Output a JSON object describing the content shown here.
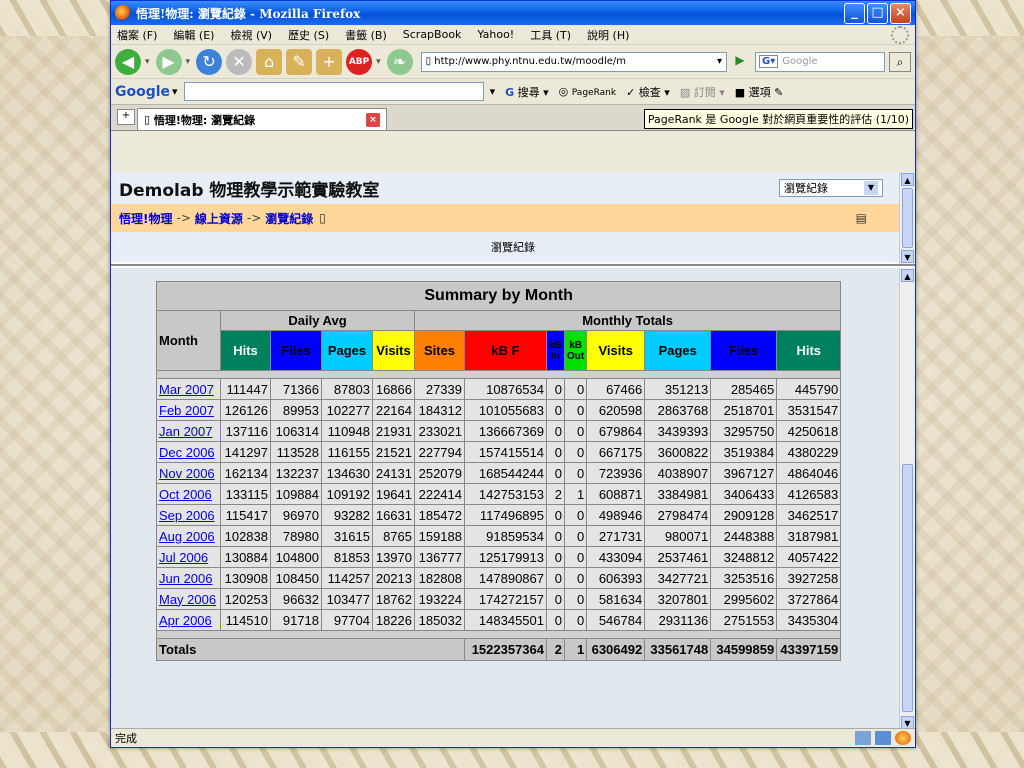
{
  "window": {
    "title": "悟理!物理: 瀏覽紀錄 - Mozilla Firefox",
    "minimize": "_",
    "maximize": "□",
    "close": "×"
  },
  "menu": [
    "檔案 (F)",
    "編輯 (E)",
    "檢視 (V)",
    "歷史 (S)",
    "書籤 (B)",
    "ScrapBook",
    "Yahoo!",
    "工具 (T)",
    "說明 (H)"
  ],
  "nav": {
    "url": "http://www.phy.ntnu.edu.tw/moodle/m",
    "search_placeholder": "Google"
  },
  "googlebar": {
    "logo": "Google",
    "search_label": "搜尋",
    "pagerank_label": "PageRank",
    "check_label": "檢查",
    "subscribe_label": "訂閱",
    "options_label": "選項"
  },
  "tab": {
    "label": "悟理!物理: 瀏覽紀錄",
    "tooltip": "PageRank 是 Google 對於網頁重要性的評估 (1/10)"
  },
  "page": {
    "site_title": "Demolab 物理教學示範實驗教室",
    "jump_select": "瀏覽紀錄",
    "breadcrumb": [
      "悟理!物理",
      "線上資源",
      "瀏覽紀錄"
    ],
    "breadcrumb_sep": "->",
    "subhead": "瀏覽紀錄"
  },
  "table": {
    "title": "Summary by Month",
    "month_label": "Month",
    "daily_avg_label": "Daily Avg",
    "monthly_totals_label": "Monthly Totals",
    "daily_cols": [
      "Hits",
      "Files",
      "Pages",
      "Visits"
    ],
    "monthly_cols": [
      "Sites",
      "kB F",
      "kB In",
      "kB Out",
      "Visits",
      "Pages",
      "Files",
      "Hits"
    ],
    "rows": [
      [
        "Mar 2007",
        "111447",
        "71366",
        "87803",
        "16866",
        "27339",
        "10876534",
        "0",
        "0",
        "67466",
        "351213",
        "285465",
        "445790"
      ],
      [
        "Feb 2007",
        "126126",
        "89953",
        "102277",
        "22164",
        "184312",
        "101055683",
        "0",
        "0",
        "620598",
        "2863768",
        "2518701",
        "3531547"
      ],
      [
        "Jan 2007",
        "137116",
        "106314",
        "110948",
        "21931",
        "233021",
        "136667369",
        "0",
        "0",
        "679864",
        "3439393",
        "3295750",
        "4250618"
      ],
      [
        "Dec 2006",
        "141297",
        "113528",
        "116155",
        "21521",
        "227794",
        "157415514",
        "0",
        "0",
        "667175",
        "3600822",
        "3519384",
        "4380229"
      ],
      [
        "Nov 2006",
        "162134",
        "132237",
        "134630",
        "24131",
        "252079",
        "168544244",
        "0",
        "0",
        "723936",
        "4038907",
        "3967127",
        "4864046"
      ],
      [
        "Oct 2006",
        "133115",
        "109884",
        "109192",
        "19641",
        "222414",
        "142753153",
        "2",
        "1",
        "608871",
        "3384981",
        "3406433",
        "4126583"
      ],
      [
        "Sep 2006",
        "115417",
        "96970",
        "93282",
        "16631",
        "185472",
        "117496895",
        "0",
        "0",
        "498946",
        "2798474",
        "2909128",
        "3462517"
      ],
      [
        "Aug 2006",
        "102838",
        "78980",
        "31615",
        "8765",
        "159188",
        "91859534",
        "0",
        "0",
        "271731",
        "980071",
        "2448388",
        "3187981"
      ],
      [
        "Jul 2006",
        "130884",
        "104800",
        "81853",
        "13970",
        "136777",
        "125179913",
        "0",
        "0",
        "433094",
        "2537461",
        "3248812",
        "4057422"
      ],
      [
        "Jun 2006",
        "130908",
        "108450",
        "114257",
        "20213",
        "182808",
        "147890867",
        "0",
        "0",
        "606393",
        "3427721",
        "3253516",
        "3927258"
      ],
      [
        "May 2006",
        "120253",
        "96632",
        "103477",
        "18762",
        "193224",
        "174272157",
        "0",
        "0",
        "581634",
        "3207801",
        "2995602",
        "3727864"
      ],
      [
        "Apr 2006",
        "114510",
        "91718",
        "97704",
        "18226",
        "185032",
        "148345501",
        "0",
        "0",
        "546784",
        "2931136",
        "2751553",
        "3435304"
      ]
    ],
    "totals_label": "Totals",
    "totals": [
      "1522357364",
      "2",
      "1",
      "6306492",
      "33561748",
      "34599859",
      "43397159"
    ]
  },
  "status": {
    "text": "完成"
  }
}
